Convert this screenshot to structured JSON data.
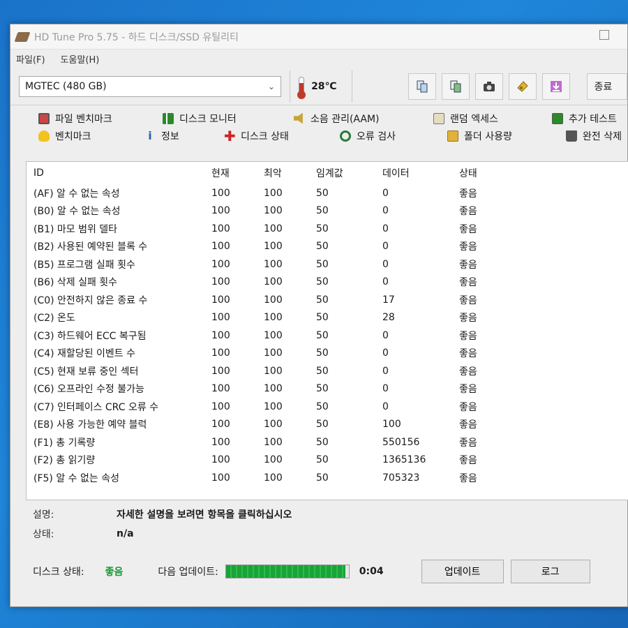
{
  "window": {
    "title": "HD Tune Pro 5.75 - 하드 디스크/SSD 유틸리티",
    "menu": [
      "파일(F)",
      "도움말(H)"
    ]
  },
  "toolbar": {
    "drive": "MGTEC (480 GB)",
    "temperature": "28℃",
    "exit_label": "종료",
    "icons": [
      "copy-icon",
      "copy-screenshot-icon",
      "camera-icon",
      "options-icon",
      "download-icon"
    ]
  },
  "tabs": {
    "row1": [
      "파일 벤치마크",
      "디스크 모니터",
      "소음 관리(AAM)",
      "랜덤 엑세스",
      "추가 테스트"
    ],
    "row2": [
      "벤치마크",
      "정보",
      "디스크 상태",
      "오류 검사",
      "폴더 사용량",
      "완전 삭제"
    ]
  },
  "smart": {
    "headers": [
      "ID",
      "현재",
      "최악",
      "임계값",
      "데이터",
      "상태"
    ],
    "rows": [
      [
        "(AF) 알 수 없는 속성",
        "100",
        "100",
        "50",
        "0",
        "좋음"
      ],
      [
        "(B0) 알 수 없는 속성",
        "100",
        "100",
        "50",
        "0",
        "좋음"
      ],
      [
        "(B1) 마모 범위 델타",
        "100",
        "100",
        "50",
        "0",
        "좋음"
      ],
      [
        "(B2) 사용된 예약된 블록 수",
        "100",
        "100",
        "50",
        "0",
        "좋음"
      ],
      [
        "(B5) 프로그램 실패 횟수",
        "100",
        "100",
        "50",
        "0",
        "좋음"
      ],
      [
        "(B6) 삭제 실패 횟수",
        "100",
        "100",
        "50",
        "0",
        "좋음"
      ],
      [
        "(C0) 안전하지 않은 종료 수",
        "100",
        "100",
        "50",
        "17",
        "좋음"
      ],
      [
        "(C2) 온도",
        "100",
        "100",
        "50",
        "28",
        "좋음"
      ],
      [
        "(C3) 하드웨어 ECC 복구됨",
        "100",
        "100",
        "50",
        "0",
        "좋음"
      ],
      [
        "(C4) 재할당된 이벤트 수",
        "100",
        "100",
        "50",
        "0",
        "좋음"
      ],
      [
        "(C5) 현재 보류 중인 섹터",
        "100",
        "100",
        "50",
        "0",
        "좋음"
      ],
      [
        "(C6) 오프라인 수정 불가능",
        "100",
        "100",
        "50",
        "0",
        "좋음"
      ],
      [
        "(C7) 인터페이스 CRC 오류 수",
        "100",
        "100",
        "50",
        "0",
        "좋음"
      ],
      [
        "(E8) 사용 가능한 예약 블럭",
        "100",
        "100",
        "50",
        "100",
        "좋음"
      ],
      [
        "(F1) 총 기록량",
        "100",
        "100",
        "50",
        "550156",
        "좋음"
      ],
      [
        "(F2) 총 읽기량",
        "100",
        "100",
        "50",
        "1365136",
        "좋음"
      ],
      [
        "(F5) 알 수 없는 속성",
        "100",
        "100",
        "50",
        "705323",
        "좋음"
      ]
    ]
  },
  "info": {
    "description_label": "설명:",
    "description_value": "자세한 설명을 보려면 항목을 클릭하십시오",
    "status_label": "상태:",
    "status_value": "n/a"
  },
  "statusbar": {
    "disk_status_label": "디스크 상태:",
    "disk_status_value": "좋음",
    "next_update_label": "다음 업데이트:",
    "progress_fraction": 0.97,
    "countdown": "0:04",
    "update_button": "업데이트",
    "log_button": "로그"
  },
  "colors": {
    "ok_green": "#1a9a3a",
    "progress_green": "#19a338",
    "desktop_blue": "#1a73c9"
  }
}
